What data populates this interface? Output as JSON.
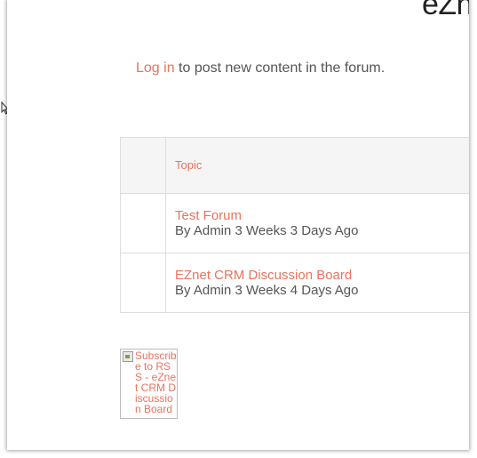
{
  "site": {
    "title": "eZn"
  },
  "login": {
    "link_label": "Log in",
    "message": " to post new content in the forum."
  },
  "forum_table": {
    "header": {
      "topic_label": "Topic"
    },
    "rows": [
      {
        "title": "Test Forum",
        "meta": "By Admin 3 Weeks 3 Days Ago"
      },
      {
        "title": "EZnet CRM Discussion Board",
        "meta": "By Admin 3 Weeks 4 Days Ago"
      }
    ]
  },
  "rss": {
    "alt_text": "Subscribe to RSS - eZnet CRM Discussion Board"
  },
  "colors": {
    "link": "#e8735e",
    "text": "#555555",
    "header_bg": "#f5f5f5",
    "border": "#dddddd"
  },
  "icons": {
    "broken_image": "broken-image-icon",
    "cursor": "mouse-pointer-icon"
  }
}
